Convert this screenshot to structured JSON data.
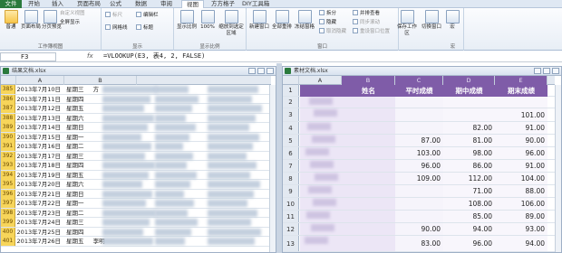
{
  "tabs": [
    "文件",
    "开始",
    "插入",
    "页面布局",
    "公式",
    "数据",
    "审阅",
    "视图",
    "方方格子",
    "DIY工具箱"
  ],
  "active_tab_index": 7,
  "ribbon": {
    "workbook_views": {
      "label": "工作簿视图",
      "normal": "普通",
      "page_layout": "页面布局",
      "page_break": "分页预览",
      "custom": "自定义视图",
      "fullscreen": "全屏显示"
    },
    "show": {
      "label": "显示",
      "ruler": "标尺",
      "gridlines": "网格线",
      "formula_bar": "编辑栏",
      "headings": "标题"
    },
    "zoom": {
      "label": "显示比例",
      "zoom": "显示比例",
      "hundred": "100%",
      "selection": "缩放到选定区域"
    },
    "window": {
      "label": "窗口",
      "new": "新建窗口",
      "arrange": "全部重排",
      "freeze": "冻结窗格",
      "split": "拆分",
      "hide": "隐藏",
      "unhide": "取消隐藏",
      "side_by_side": "并排查看",
      "sync_scroll": "同步滚动",
      "reset": "重设窗口位置",
      "save_workspace": "保存工作区",
      "switch": "切换窗口"
    },
    "macros": {
      "label": "宏",
      "macro": "宏"
    }
  },
  "formula_bar": {
    "name_box": "F3",
    "fx": "fx",
    "formula": "=VLOOKUP(E3, 表4, 2, FALSE)"
  },
  "left_pane": {
    "title": "结果文档.xlsx",
    "columns": [
      "A",
      "B"
    ],
    "rows": [
      {
        "n": "385",
        "date": "2013年7月10日",
        "day": "星期三",
        "extra": "方"
      },
      {
        "n": "386",
        "date": "2013年7月11日",
        "day": "星期四",
        "extra": ""
      },
      {
        "n": "387",
        "date": "2013年7月12日",
        "day": "星期五",
        "extra": ""
      },
      {
        "n": "388",
        "date": "2013年7月13日",
        "day": "星期六",
        "extra": ""
      },
      {
        "n": "389",
        "date": "2013年7月14日",
        "day": "星期日",
        "extra": ""
      },
      {
        "n": "390",
        "date": "2013年7月15日",
        "day": "星期一",
        "extra": ""
      },
      {
        "n": "391",
        "date": "2013年7月16日",
        "day": "星期二",
        "extra": ""
      },
      {
        "n": "392",
        "date": "2013年7月17日",
        "day": "星期三",
        "extra": ""
      },
      {
        "n": "393",
        "date": "2013年7月18日",
        "day": "星期四",
        "extra": ""
      },
      {
        "n": "394",
        "date": "2013年7月19日",
        "day": "星期五",
        "extra": ""
      },
      {
        "n": "395",
        "date": "2013年7月20日",
        "day": "星期六",
        "extra": ""
      },
      {
        "n": "396",
        "date": "2013年7月21日",
        "day": "星期日",
        "extra": ""
      },
      {
        "n": "397",
        "date": "2013年7月22日",
        "day": "星期一",
        "extra": ""
      },
      {
        "n": "398",
        "date": "2013年7月23日",
        "day": "星期二",
        "extra": ""
      },
      {
        "n": "399",
        "date": "2013年7月24日",
        "day": "星期三",
        "extra": ""
      },
      {
        "n": "400",
        "date": "2013年7月25日",
        "day": "星期四",
        "extra": ""
      },
      {
        "n": "401",
        "date": "2013年7月26日",
        "day": "星期五",
        "extra": "李明"
      }
    ]
  },
  "right_pane": {
    "title": "素材文档.xlsx",
    "columns": [
      "A",
      "B",
      "C",
      "D",
      "E"
    ],
    "headers": [
      "",
      "姓名",
      "平时成绩",
      "期中成绩",
      "期末成绩"
    ],
    "rows": [
      {
        "n": "1",
        "c": "",
        "d": "",
        "e": ""
      },
      {
        "n": "2",
        "c": "",
        "d": "",
        "e": ""
      },
      {
        "n": "3",
        "c": "",
        "d": "",
        "e": "101.00"
      },
      {
        "n": "4",
        "c": "",
        "d": "82.00",
        "e": "91.00"
      },
      {
        "n": "5",
        "c": "87.00",
        "d": "81.00",
        "e": "90.00"
      },
      {
        "n": "6",
        "c": "103.00",
        "d": "98.00",
        "e": "96.00"
      },
      {
        "n": "7",
        "c": "96.00",
        "d": "86.00",
        "e": "91.00"
      },
      {
        "n": "8",
        "c": "109.00",
        "d": "112.00",
        "e": "104.00"
      },
      {
        "n": "9",
        "c": "",
        "d": "71.00",
        "e": "88.00"
      },
      {
        "n": "10",
        "c": "",
        "d": "108.00",
        "e": "106.00"
      },
      {
        "n": "11",
        "c": "",
        "d": "85.00",
        "e": "89.00"
      },
      {
        "n": "12",
        "c": "90.00",
        "d": "94.00",
        "e": "93.00"
      },
      {
        "n": "13",
        "c": "83.00",
        "d": "96.00",
        "e": "94.00"
      }
    ]
  },
  "colors": {
    "excel_green": "#2a7a3c",
    "row_header_highlight": "#f7d55a",
    "purple_header": "#7f5ca8",
    "purple_fill": "#ddd2ee"
  }
}
